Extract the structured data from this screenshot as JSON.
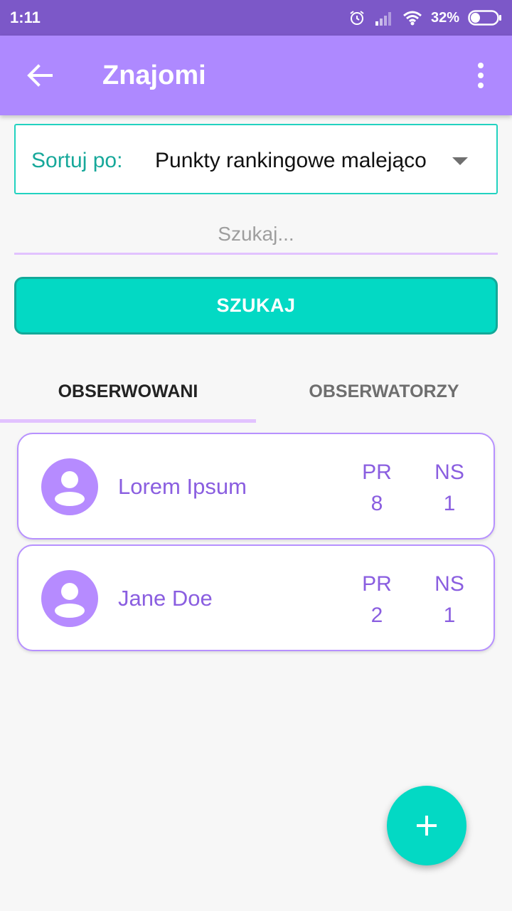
{
  "status_bar": {
    "time": "1:11",
    "battery": "32%"
  },
  "app_bar": {
    "title": "Znajomi",
    "back_icon": "arrow-back-icon",
    "menu_icon": "more-vert-icon"
  },
  "sort": {
    "label": "Sortuj po:",
    "value": "Punkty rankingowe malejąco"
  },
  "search": {
    "placeholder": "Szukaj...",
    "value": "",
    "button_label": "SZUKAJ"
  },
  "tabs": [
    {
      "label": "OBSERWOWANI",
      "active": true
    },
    {
      "label": "OBSERWATORZY",
      "active": false
    }
  ],
  "friends": [
    {
      "name": "Lorem Ipsum",
      "pr_label": "PR",
      "pr": "8",
      "ns_label": "NS",
      "ns": "1"
    },
    {
      "name": "Jane Doe",
      "pr_label": "PR",
      "pr": "2",
      "ns_label": "NS",
      "ns": "1"
    }
  ],
  "fab": {
    "icon": "plus-icon"
  },
  "colors": {
    "status_bar": "#7c58c8",
    "app_bar": "#ae89ff",
    "accent": "#03d9c4",
    "card_text": "#8a5ee0",
    "avatar": "#b68bff"
  }
}
